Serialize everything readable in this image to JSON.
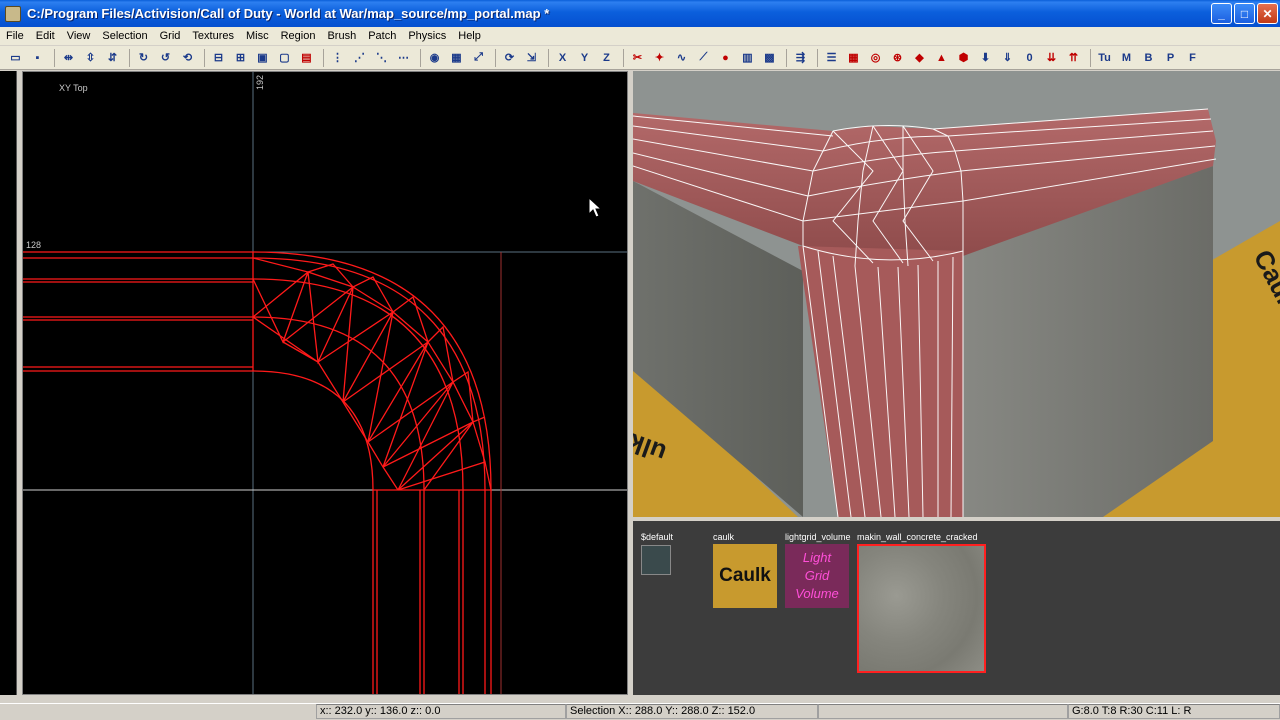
{
  "window": {
    "title": "C:/Program Files/Activision/Call of Duty - World at War/map_source/mp_portal.map *"
  },
  "menu": [
    "File",
    "Edit",
    "View",
    "Selection",
    "Grid",
    "Textures",
    "Misc",
    "Region",
    "Brush",
    "Patch",
    "Physics",
    "Help"
  ],
  "toolbar": {
    "icons": [
      "open-icon",
      "save-icon",
      "flip-x-icon",
      "flip-y-icon",
      "flip-z-icon",
      "rotate-x-icon",
      "rotate-y-icon",
      "rotate-z-icon",
      "csg-subtract-icon",
      "csg-merge-icon",
      "hollow-icon",
      "make-room-icon",
      "clipper-icon",
      "select-inside-icon",
      "select-touching-icon",
      "select-partial-icon",
      "select-complete-icon",
      "camera-icon",
      "texture-icon",
      "scale-icon",
      "rotate-icon",
      "drag-icon",
      "view-x-icon",
      "view-y-icon",
      "view-z-icon"
    ],
    "letters": [
      "X",
      "Y",
      "Z",
      "Tu",
      "M",
      "B",
      "P",
      "F"
    ]
  },
  "viewport2d": {
    "label": "XY Top",
    "coord_top": "192",
    "coord_left": "128"
  },
  "textures": [
    {
      "name": "$default",
      "swatch": "#3a4a4c"
    },
    {
      "name": "caulk",
      "caption": "Caulk",
      "swatch": "#c89a2e"
    },
    {
      "name": "lightgrid_volume",
      "caption_lines": [
        "Light",
        "Grid",
        "Volume"
      ],
      "swatch": "#7a2a5a"
    },
    {
      "name": "makin_wall_concrete_cracked",
      "swatch": "#8a8a82"
    }
  ],
  "caulk_floor_text": "Caulk Caulk Caulk",
  "caulk_floor_text_left": "ulk",
  "status": {
    "coords": "x:: 232.0  y:: 136.0  z:: 0.0",
    "selection": "Selection X:: 288.0  Y:: 288.0  Z:: 152.0",
    "grid": "G:8.0 T:8 R:30 C:11 L: R"
  },
  "colors": {
    "title_bar": "#0b5fdc",
    "wire_red": "#ff0000",
    "wire_white": "#ffffff"
  }
}
